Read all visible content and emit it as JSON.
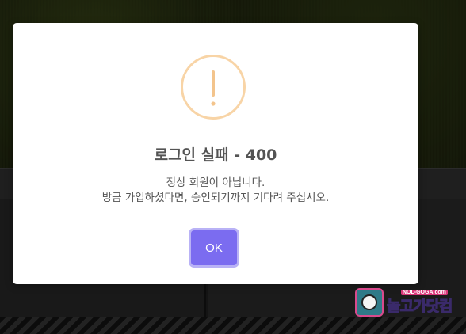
{
  "dialog": {
    "title": "로그인 실패 - 400",
    "message_line1": "정상 회원이 아닙니다.",
    "message_line2": "방금 가입하셨다면, 승인되기까지 기다려 주십시오.",
    "ok_label": "OK",
    "icon": "warning-exclamation-icon",
    "icon_color": "#f8d4a6",
    "button_color": "#7b6cf0"
  },
  "watermark": {
    "brand_main": "놀고가닷컴",
    "brand_sub": "NOL-GOGA.com",
    "icon": "soccer-ball-tv-icon"
  }
}
